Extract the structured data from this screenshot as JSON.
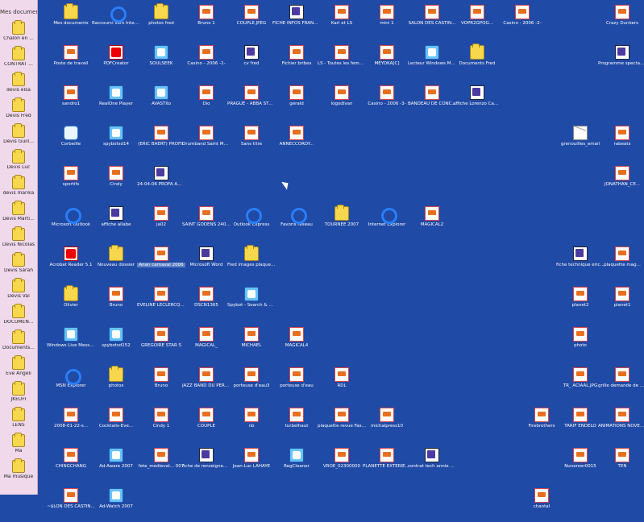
{
  "sidebar": {
    "title": "Mes documents",
    "items": [
      "Chalon en ...",
      "CONTRAT ...",
      "devis elsa",
      "Devis Fred",
      "Devis Guill...",
      "Devis Luc",
      "devis marika",
      "Devis Marti...",
      "Devis Nicolas",
      "Devis Sarah",
      "Devis Val",
      "DOCUMEN...",
      "Documents...",
      "Eve Angeli",
      "JKEUFI",
      "LENS",
      "Ma",
      "Ma musique"
    ]
  },
  "desktop": {
    "row1": [
      "Mes documents",
      "Raccourci vers Internet Ex...",
      "photos fred",
      "Bruno 1",
      "COUPLE.JPEG",
      "FICHE INFOS FRANCAIS",
      "Karl et LS",
      "mini 1",
      "SALON DES CASTIN...",
      "VOPR2GPOG...",
      "Casino - 2006 -2-",
      "Crazy Dunkers"
    ],
    "row2": [
      "Poste de travail",
      "PDFCreator",
      "SOULSEEK",
      "Casino - 2006 -1-",
      "cv fred",
      "Fichier bribes",
      "LS - Toutes les femmes de ...",
      "MEYOKA[C]",
      "Lecteur Windows Media",
      "Documents Fred",
      "Programme spectacle chez..."
    ],
    "row3": [
      "sandro1",
      "RealOne Player",
      "AVASTIIo",
      "Dio",
      "PRAGUE - ABBA STARS 070",
      "gerald",
      "logodivan",
      "Casino - 2006 -3-",
      "BANDEAU DE CONCERT",
      "affiche Lorenzo Cammotti Plu..."
    ],
    "row4": [
      "Corbeille",
      "spybotsd14",
      "(ERIC BAERT) PROFIL",
      "Drumband Saint Martinois",
      "Sans titre",
      "ANNECCORDY...",
      "grenouilles_email",
      "rabeats"
    ],
    "row5": [
      "sportifs",
      "Cindy",
      "24-04-06 PROFA AMOURS OPE...",
      "JONATHAN_CE..."
    ],
    "row6": [
      "Microsoft Outlook",
      "affiche allabe",
      "ja02",
      "SAINT GODENS 240307",
      "Outlook Express",
      "Favoris réseau",
      "TOURNEE 2007",
      "Internet Explorer",
      "MAGICAL2"
    ],
    "row7": [
      "Acrobat Reader 5.1",
      "Nouveau dossier",
      "Anan carnaval 2006",
      "Microsoft Word",
      "Fred images plaquettes",
      "fiche technique eric baert",
      "plaquette mag..."
    ],
    "row8": [
      "Olivier",
      "Bruno",
      "EVELINE LECLERCQ S...",
      "DSCN1365",
      "Spybot - Search & Destroy",
      "planet2",
      "planet1"
    ],
    "row9": [
      "Windows Live Messenger",
      "spybotsd152",
      "GREGOIRE STAR S",
      "MAGICAL_",
      "MICHAEL",
      "MAGICAL4",
      "photo"
    ],
    "row10": [
      "MSN Explorer",
      "photos",
      "Bruno",
      "JAZZ BAND DU PERE NOEL",
      "porteuse d'eau3",
      "porteuse d'eau",
      "RDL",
      "TR_ ACIAAL.JPG",
      "grille demande de badge 26"
    ],
    "row11": [
      "2008-01-22-s...",
      "Cocktails-Eve...",
      "Cindy 1",
      "COUPLE",
      "nb",
      "turbelhaut",
      "plaquette revue Fascination",
      "michalpress10",
      "Firebrothers",
      "TARIF ENDELO",
      "ANIMATIONS NOVEMBRE 2007"
    ],
    "row12": [
      "CHINGCHANG",
      "Ad-Aware 2007",
      "fete_medieval... 007",
      "fiche de renseignem...",
      "Jean-Luc LAHAYE",
      "RegCleaner",
      "VROE_02300000",
      "PLANETTE EXTERIEURE_...",
      "contrat tech annie cordy",
      "Nuneroer0015",
      "TEN"
    ],
    "row13": [
      "~$LON DES CASTIN...",
      "Ad-Watch 2007",
      "chantal"
    ]
  },
  "colors": {
    "desktop": "#1f4aa6",
    "sidebar": "#f1d9ec",
    "label_text": "#ffffff"
  }
}
